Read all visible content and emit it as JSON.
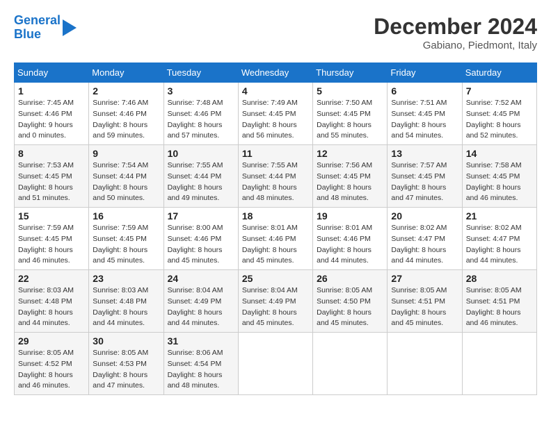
{
  "header": {
    "logo_line1": "General",
    "logo_line2": "Blue",
    "month": "December 2024",
    "location": "Gabiano, Piedmont, Italy"
  },
  "days_of_week": [
    "Sunday",
    "Monday",
    "Tuesday",
    "Wednesday",
    "Thursday",
    "Friday",
    "Saturday"
  ],
  "weeks": [
    [
      {
        "day": "1",
        "sunrise": "7:45 AM",
        "sunset": "4:46 PM",
        "daylight": "9 hours and 0 minutes."
      },
      {
        "day": "2",
        "sunrise": "7:46 AM",
        "sunset": "4:46 PM",
        "daylight": "8 hours and 59 minutes."
      },
      {
        "day": "3",
        "sunrise": "7:48 AM",
        "sunset": "4:46 PM",
        "daylight": "8 hours and 57 minutes."
      },
      {
        "day": "4",
        "sunrise": "7:49 AM",
        "sunset": "4:45 PM",
        "daylight": "8 hours and 56 minutes."
      },
      {
        "day": "5",
        "sunrise": "7:50 AM",
        "sunset": "4:45 PM",
        "daylight": "8 hours and 55 minutes."
      },
      {
        "day": "6",
        "sunrise": "7:51 AM",
        "sunset": "4:45 PM",
        "daylight": "8 hours and 54 minutes."
      },
      {
        "day": "7",
        "sunrise": "7:52 AM",
        "sunset": "4:45 PM",
        "daylight": "8 hours and 52 minutes."
      }
    ],
    [
      {
        "day": "8",
        "sunrise": "7:53 AM",
        "sunset": "4:45 PM",
        "daylight": "8 hours and 51 minutes."
      },
      {
        "day": "9",
        "sunrise": "7:54 AM",
        "sunset": "4:44 PM",
        "daylight": "8 hours and 50 minutes."
      },
      {
        "day": "10",
        "sunrise": "7:55 AM",
        "sunset": "4:44 PM",
        "daylight": "8 hours and 49 minutes."
      },
      {
        "day": "11",
        "sunrise": "7:55 AM",
        "sunset": "4:44 PM",
        "daylight": "8 hours and 48 minutes."
      },
      {
        "day": "12",
        "sunrise": "7:56 AM",
        "sunset": "4:45 PM",
        "daylight": "8 hours and 48 minutes."
      },
      {
        "day": "13",
        "sunrise": "7:57 AM",
        "sunset": "4:45 PM",
        "daylight": "8 hours and 47 minutes."
      },
      {
        "day": "14",
        "sunrise": "7:58 AM",
        "sunset": "4:45 PM",
        "daylight": "8 hours and 46 minutes."
      }
    ],
    [
      {
        "day": "15",
        "sunrise": "7:59 AM",
        "sunset": "4:45 PM",
        "daylight": "8 hours and 46 minutes."
      },
      {
        "day": "16",
        "sunrise": "7:59 AM",
        "sunset": "4:45 PM",
        "daylight": "8 hours and 45 minutes."
      },
      {
        "day": "17",
        "sunrise": "8:00 AM",
        "sunset": "4:46 PM",
        "daylight": "8 hours and 45 minutes."
      },
      {
        "day": "18",
        "sunrise": "8:01 AM",
        "sunset": "4:46 PM",
        "daylight": "8 hours and 45 minutes."
      },
      {
        "day": "19",
        "sunrise": "8:01 AM",
        "sunset": "4:46 PM",
        "daylight": "8 hours and 44 minutes."
      },
      {
        "day": "20",
        "sunrise": "8:02 AM",
        "sunset": "4:47 PM",
        "daylight": "8 hours and 44 minutes."
      },
      {
        "day": "21",
        "sunrise": "8:02 AM",
        "sunset": "4:47 PM",
        "daylight": "8 hours and 44 minutes."
      }
    ],
    [
      {
        "day": "22",
        "sunrise": "8:03 AM",
        "sunset": "4:48 PM",
        "daylight": "8 hours and 44 minutes."
      },
      {
        "day": "23",
        "sunrise": "8:03 AM",
        "sunset": "4:48 PM",
        "daylight": "8 hours and 44 minutes."
      },
      {
        "day": "24",
        "sunrise": "8:04 AM",
        "sunset": "4:49 PM",
        "daylight": "8 hours and 44 minutes."
      },
      {
        "day": "25",
        "sunrise": "8:04 AM",
        "sunset": "4:49 PM",
        "daylight": "8 hours and 45 minutes."
      },
      {
        "day": "26",
        "sunrise": "8:05 AM",
        "sunset": "4:50 PM",
        "daylight": "8 hours and 45 minutes."
      },
      {
        "day": "27",
        "sunrise": "8:05 AM",
        "sunset": "4:51 PM",
        "daylight": "8 hours and 45 minutes."
      },
      {
        "day": "28",
        "sunrise": "8:05 AM",
        "sunset": "4:51 PM",
        "daylight": "8 hours and 46 minutes."
      }
    ],
    [
      {
        "day": "29",
        "sunrise": "8:05 AM",
        "sunset": "4:52 PM",
        "daylight": "8 hours and 46 minutes."
      },
      {
        "day": "30",
        "sunrise": "8:05 AM",
        "sunset": "4:53 PM",
        "daylight": "8 hours and 47 minutes."
      },
      {
        "day": "31",
        "sunrise": "8:06 AM",
        "sunset": "4:54 PM",
        "daylight": "8 hours and 48 minutes."
      },
      null,
      null,
      null,
      null
    ]
  ],
  "labels": {
    "sunrise": "Sunrise:",
    "sunset": "Sunset:",
    "daylight": "Daylight:"
  }
}
